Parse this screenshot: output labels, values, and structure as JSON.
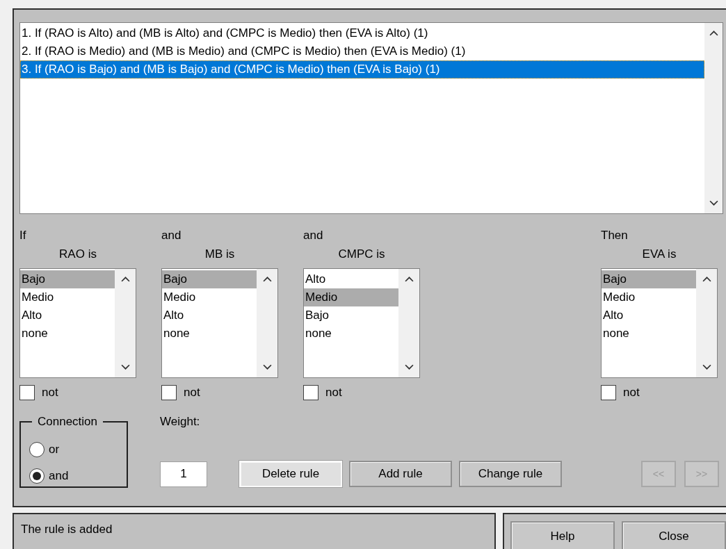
{
  "rules": [
    {
      "text": "1. If (RAO is Alto) and (MB is Alto) and (CMPC is Medio) then (EVA is Alto) (1)",
      "selected": false
    },
    {
      "text": "2. If (RAO is Medio) and (MB is Medio) and (CMPC is Medio) then (EVA is Medio) (1)",
      "selected": false
    },
    {
      "text": "3. If (RAO is Bajo) and (MB is Bajo) and (CMPC is Medio) then (EVA is Bajo) (1)",
      "selected": true
    }
  ],
  "columns": [
    {
      "connector": "If",
      "label": "RAO is",
      "options": [
        {
          "label": "Bajo",
          "selected": true
        },
        {
          "label": "Medio",
          "selected": false
        },
        {
          "label": "Alto",
          "selected": false
        },
        {
          "label": "none",
          "selected": false
        }
      ],
      "not": {
        "label": "not",
        "checked": false
      }
    },
    {
      "connector": "and",
      "label": "MB is",
      "options": [
        {
          "label": "Bajo",
          "selected": true
        },
        {
          "label": "Medio",
          "selected": false
        },
        {
          "label": "Alto",
          "selected": false
        },
        {
          "label": "none",
          "selected": false
        }
      ],
      "not": {
        "label": "not",
        "checked": false
      }
    },
    {
      "connector": "and",
      "label": "CMPC is",
      "options": [
        {
          "label": "Alto",
          "selected": false
        },
        {
          "label": "Medio",
          "selected": true
        },
        {
          "label": "Bajo",
          "selected": false
        },
        {
          "label": "none",
          "selected": false
        }
      ],
      "not": {
        "label": "not",
        "checked": false
      }
    },
    {
      "connector": "Then",
      "label": "EVA is",
      "options": [
        {
          "label": "Bajo",
          "selected": true
        },
        {
          "label": "Medio",
          "selected": false
        },
        {
          "label": "Alto",
          "selected": false
        },
        {
          "label": "none",
          "selected": false
        }
      ],
      "not": {
        "label": "not",
        "checked": false
      }
    }
  ],
  "connection": {
    "title": "Connection",
    "options": [
      {
        "label": "or",
        "selected": false
      },
      {
        "label": "and",
        "selected": true
      }
    ]
  },
  "weight": {
    "label": "Weight:",
    "value": "1"
  },
  "rule_buttons": [
    {
      "label": "Delete rule",
      "highlighted": true
    },
    {
      "label": "Add rule",
      "highlighted": false
    },
    {
      "label": "Change rule",
      "highlighted": false
    }
  ],
  "nav_buttons": [
    {
      "label": "<<",
      "disabled": true
    },
    {
      "label": ">>",
      "disabled": true
    }
  ],
  "status": "The rule is added",
  "footer_buttons": [
    "Help",
    "Close"
  ]
}
